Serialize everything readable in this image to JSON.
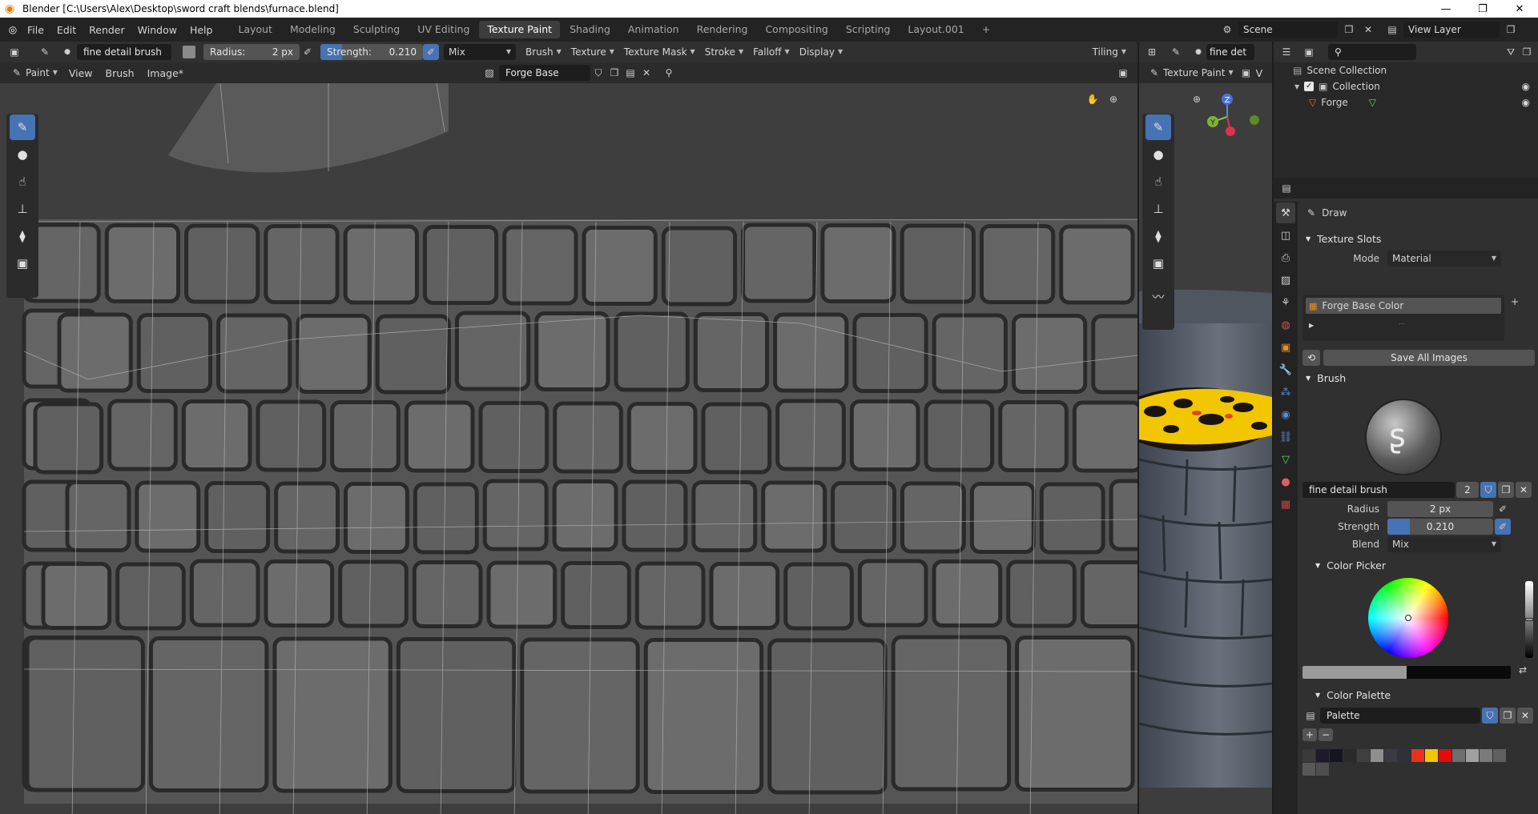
{
  "window": {
    "title": "Blender [C:\\Users\\Alex\\Desktop\\sword craft blends\\furnace.blend]",
    "controls": [
      "—",
      "❐",
      "✕"
    ]
  },
  "menu": [
    "File",
    "Edit",
    "Render",
    "Window",
    "Help"
  ],
  "workspaces": {
    "tabs": [
      "Layout",
      "Modeling",
      "Sculpting",
      "UV Editing",
      "Texture Paint",
      "Shading",
      "Animation",
      "Rendering",
      "Compositing",
      "Scripting",
      "Layout.001"
    ],
    "active": "Texture Paint",
    "add": "+"
  },
  "scene": {
    "name": "Scene",
    "view_layer": "View Layer"
  },
  "image_editor": {
    "tool_header": {
      "brush_name": "fine detail brush",
      "radius_label": "Radius:",
      "radius_value": "2 px",
      "strength_label": "Strength:",
      "strength_value": "0.210",
      "strength_fraction": 0.21,
      "blend": "Mix",
      "dropdowns": [
        "Brush",
        "Texture",
        "Texture Mask",
        "Stroke",
        "Falloff",
        "Display"
      ],
      "tiling": "Tiling"
    },
    "header": {
      "mode": "Paint",
      "menus": [
        "View",
        "Brush",
        "Image*"
      ],
      "image_name": "Forge Base Color"
    }
  },
  "viewport": {
    "header": {
      "brush_name": "fine det",
      "mode": "Texture Paint",
      "view": "V"
    },
    "gizmo": {
      "z": "Z",
      "y": "Y"
    }
  },
  "outliner": {
    "root": "Scene Collection",
    "items": [
      {
        "name": "Collection",
        "icon": "collection-icon"
      },
      {
        "name": "Forge",
        "icon": "mesh-object-icon"
      }
    ]
  },
  "properties": {
    "tool_name": "Draw",
    "texture_slots": {
      "title": "Texture Slots",
      "mode_label": "Mode",
      "mode_value": "Material",
      "slot": "Forge Base Color",
      "save_all": "Save All Images"
    },
    "brush": {
      "title": "Brush",
      "name": "fine detail brush",
      "users": "2",
      "radius_label": "Radius",
      "radius_value": "2 px",
      "strength_label": "Strength",
      "strength_value": "0.210",
      "strength_fraction": 0.21,
      "blend_label": "Blend",
      "blend_value": "Mix"
    },
    "color_picker": {
      "title": "Color Picker",
      "value_fraction": 0.5
    },
    "color_palette": {
      "title": "Color Palette",
      "name": "Palette",
      "swatches": [
        "#3a3a3a",
        "#1e1a2a",
        "#151520",
        "#2a2a2a",
        "#404040",
        "#8f8f8f",
        "#3a3a42",
        "#303038",
        "#e6321e",
        "#f2c600",
        "#e60a0a",
        "#6e6e6e",
        "#a0a0a0",
        "#7a7a7a",
        "#606060",
        "#585858",
        "#4e4e4e"
      ]
    }
  },
  "colors": {
    "accent": "#4772b3",
    "bg": "#1d1d1d",
    "panel": "#303030",
    "header": "#232323"
  }
}
